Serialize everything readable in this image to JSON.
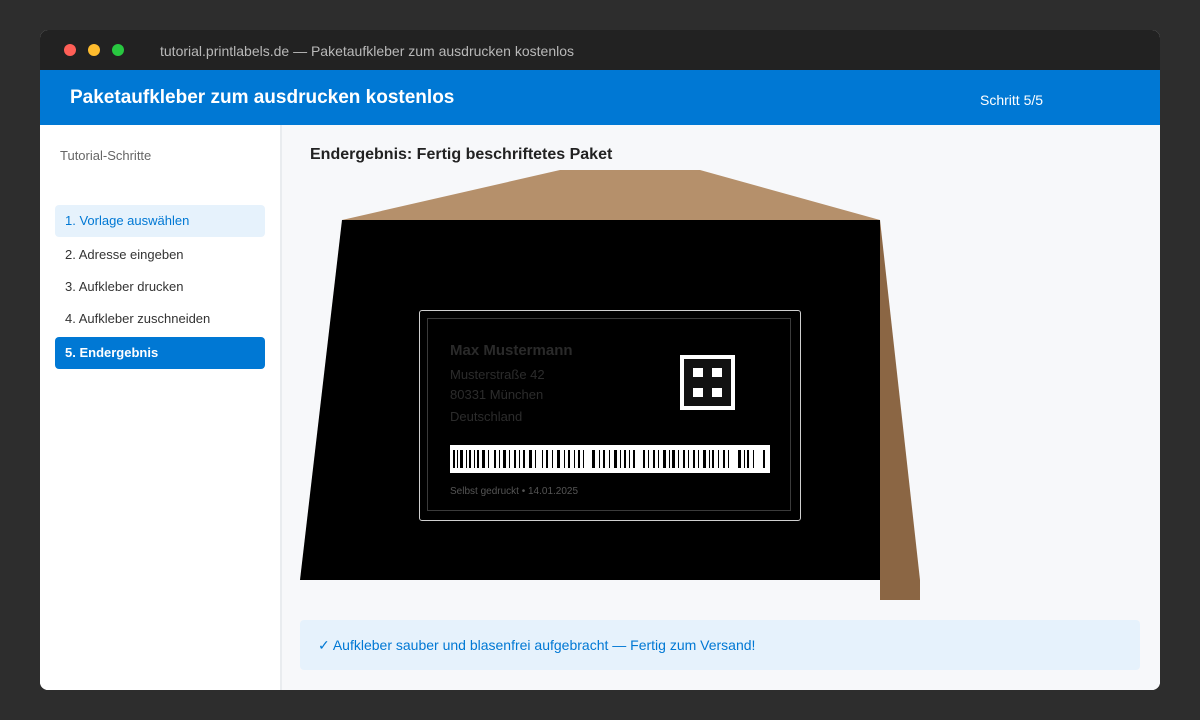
{
  "window": {
    "title": "tutorial.printlabels.de — Paketaufkleber zum ausdrucken kostenlos"
  },
  "header": {
    "title": "Paketaufkleber zum ausdrucken kostenlos",
    "step": "Schritt 5/5"
  },
  "sidebar": {
    "heading": "Tutorial-Schritte",
    "items": [
      {
        "label": "1. Vorlage auswählen",
        "state": "done"
      },
      {
        "label": "2. Adresse eingeben",
        "state": "default"
      },
      {
        "label": "3. Aufkleber drucken",
        "state": "default"
      },
      {
        "label": "4. Aufkleber zuschneiden",
        "state": "default"
      },
      {
        "label": "5. Endergebnis",
        "state": "active"
      }
    ]
  },
  "main": {
    "title": "Endergebnis: Fertig beschriftetes Paket",
    "label": {
      "name": "Max Mustermann",
      "street": "Musterstraße 42",
      "city": "80331 München",
      "country": "Deutschland",
      "footer": "Selbst gedruckt • 14.01.2025"
    },
    "status": "✓ Aufkleber sauber und blasenfrei aufgebracht — Fertig zum Versand!"
  },
  "colors": {
    "accent": "#0078d4",
    "package_flap": "#b5906b",
    "package_side": "#8b6644",
    "package_front": "#000000",
    "status_bg": "#e6f2fc"
  }
}
